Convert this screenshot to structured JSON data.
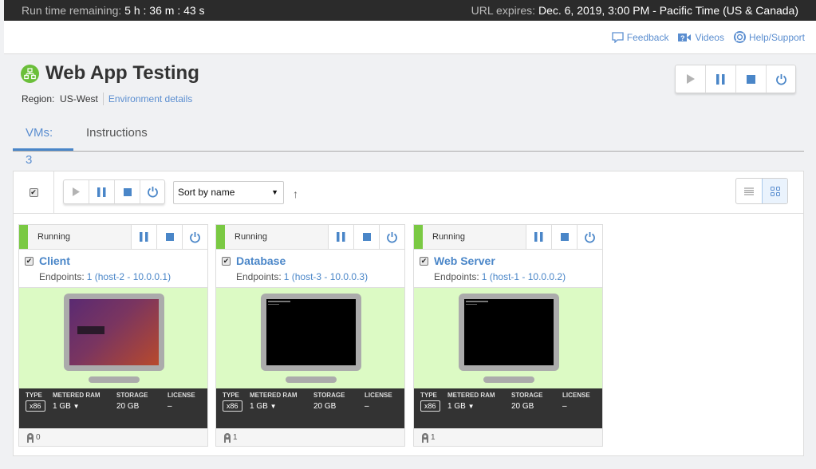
{
  "topbar": {
    "runtime_label": "Run time remaining:",
    "runtime_value": "5 h : 36 m : 43 s",
    "url_label": "URL expires:",
    "url_value": "Dec. 6, 2019, 3:00 PM - Pacific Time (US & Canada)"
  },
  "helplinks": [
    {
      "label": "Feedback",
      "icon": "feedback-icon"
    },
    {
      "label": "Videos",
      "icon": "video-icon"
    },
    {
      "label": "Help/Support",
      "icon": "lifebuoy-icon"
    }
  ],
  "environment": {
    "title": "Web App Testing",
    "region_label": "Region:",
    "region_value": "US-West",
    "details_link": "Environment details"
  },
  "tabs": [
    {
      "label": "VMs: 3",
      "active": true
    },
    {
      "label": "Instructions",
      "active": false
    }
  ],
  "toolbar": {
    "sort_selected": "Sort by name",
    "sort_direction": "↑",
    "view_modes": [
      "list",
      "grid"
    ],
    "active_view": "grid"
  },
  "colors": {
    "accent": "#4a86c8",
    "running": "#7ac943",
    "screen_bg": "#dcfac4"
  },
  "vms": [
    {
      "status": "Running",
      "name": "Client",
      "endpoints_label": "Endpoints:",
      "endpoints": "1 (host-2 - 10.0.0.1)",
      "type": "x86",
      "ram": "1 GB",
      "storage": "20 GB",
      "license": "–",
      "users": "0",
      "screen": "ubuntu-desktop"
    },
    {
      "status": "Running",
      "name": "Database",
      "endpoints_label": "Endpoints:",
      "endpoints": "1 (host-3 - 10.0.0.3)",
      "type": "x86",
      "ram": "1 GB",
      "storage": "20 GB",
      "license": "–",
      "users": "1",
      "screen": "console"
    },
    {
      "status": "Running",
      "name": "Web Server",
      "endpoints_label": "Endpoints:",
      "endpoints": "1 (host-1 - 10.0.0.2)",
      "type": "x86",
      "ram": "1 GB",
      "storage": "20 GB",
      "license": "–",
      "users": "1",
      "screen": "console"
    }
  ],
  "spec_headers": {
    "type": "TYPE",
    "ram": "METERED RAM",
    "storage": "STORAGE",
    "license": "LICENSE"
  }
}
